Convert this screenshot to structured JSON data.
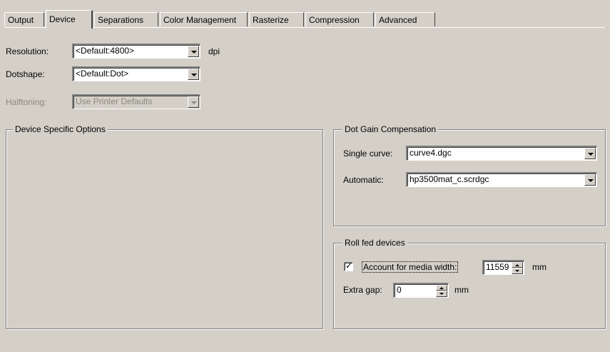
{
  "tabs": [
    {
      "label": "Output"
    },
    {
      "label": "Device",
      "active": true
    },
    {
      "label": "Separations"
    },
    {
      "label": "Color Management"
    },
    {
      "label": "Rasterize"
    },
    {
      "label": "Compression"
    },
    {
      "label": "Advanced"
    }
  ],
  "resolution": {
    "label": "Resolution:",
    "value": "<Default:4800>",
    "unit": "dpi"
  },
  "dotshape": {
    "label": "Dotshape:",
    "value": "<Default:Dot>"
  },
  "halftoning": {
    "label": "Halftoning:",
    "value": "Use Printer Defaults",
    "disabled": true
  },
  "device_options": {
    "title": "Device Specific Options"
  },
  "dot_gain": {
    "title": "Dot Gain Compensation",
    "single_curve": {
      "label": "Single curve:",
      "value": "curve4.dgc"
    },
    "automatic": {
      "label": "Automatic:",
      "value": "hp3500mat_c.scrdgc"
    }
  },
  "roll_fed": {
    "title": "Roll fed devices",
    "account_media_width": {
      "label": "Account for media width:",
      "checked": true,
      "value": "11559",
      "unit": "mm"
    },
    "extra_gap": {
      "label": "Extra gap:",
      "value": "0",
      "unit": "mm"
    }
  },
  "colors": {
    "face": "#d4d0c8",
    "shadow": "#808080",
    "highlight": "#ffffff",
    "disabled_text": "#8a8780"
  }
}
